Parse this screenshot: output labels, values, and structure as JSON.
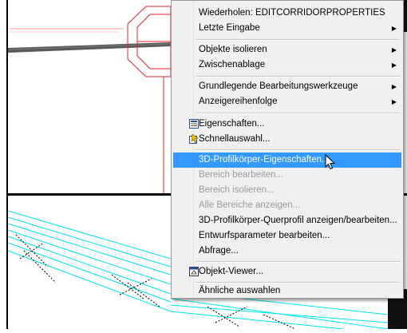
{
  "menu": {
    "items": [
      {
        "label": "Wiederholen: EDITCORRIDORPROPERTIES",
        "state": "normal",
        "submenu": false
      },
      {
        "label": "Letzte Eingabe",
        "state": "normal",
        "submenu": true
      },
      {
        "label": "Objekte isolieren",
        "state": "normal",
        "submenu": true
      },
      {
        "label": "Zwischenablage",
        "state": "normal",
        "submenu": true
      },
      {
        "label": "Grundlegende Bearbeitungswerkzeuge",
        "state": "normal",
        "submenu": true
      },
      {
        "label": "Anzeigereihenfolge",
        "state": "normal",
        "submenu": true
      },
      {
        "label": "Eigenschaften...",
        "state": "normal",
        "icon": "properties-icon"
      },
      {
        "label": "Schnellauswahl...",
        "state": "normal",
        "icon": "quick-select-icon"
      },
      {
        "label": "3D-Profilkörper-Eigenschaften...",
        "state": "hovered"
      },
      {
        "label": "Bereich bearbeiten...",
        "state": "disabled"
      },
      {
        "label": "Bereich isolieren...",
        "state": "disabled"
      },
      {
        "label": "Alle Bereiche anzeigen...",
        "state": "disabled"
      },
      {
        "label": "3D-Profilkörper-Querprofil anzeigen/bearbeiten...",
        "state": "normal"
      },
      {
        "label": "Entwurfsparameter bearbeiten...",
        "state": "normal"
      },
      {
        "label": "Abfrage...",
        "state": "normal"
      },
      {
        "label": "Objekt-Viewer...",
        "state": "normal",
        "icon": "object-viewer-icon"
      },
      {
        "label": "Ähnliche auswahlen",
        "state": "normal"
      }
    ]
  },
  "colors": {
    "menu_bg": "#f0f0f0",
    "hover": "#3399ff",
    "disabled_text": "#9a9a9a",
    "cad_red": "#e8222a",
    "cad_cyan": "#00e5ee"
  }
}
